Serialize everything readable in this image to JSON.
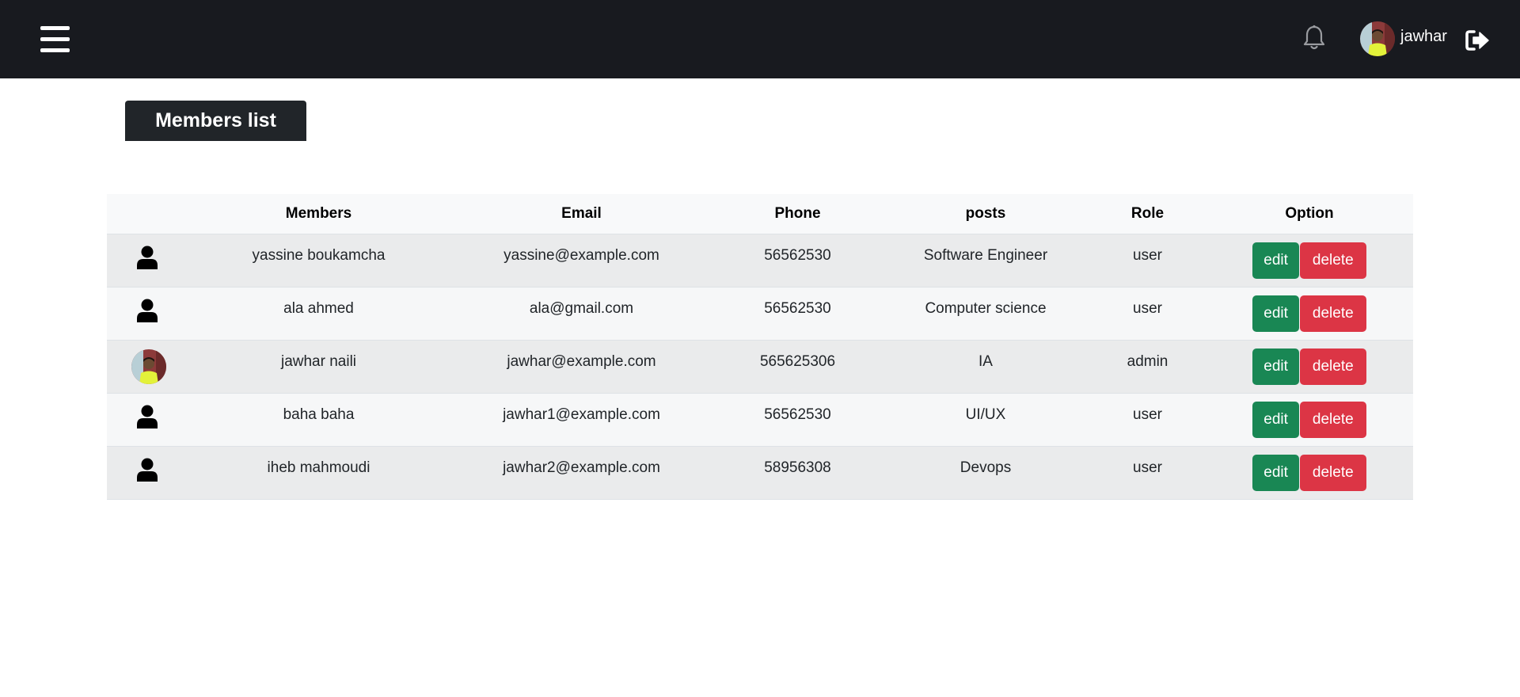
{
  "header": {
    "username": "jawhar"
  },
  "page": {
    "title": "Members list"
  },
  "table": {
    "columns": [
      "",
      "Members",
      "Email",
      "Phone",
      "posts",
      "Role",
      "Option"
    ],
    "rows": [
      {
        "avatar": "person-icon",
        "name": "yassine boukamcha",
        "email": "yassine@example.com",
        "phone": "56562530",
        "post": "Software Engineer",
        "role": "user"
      },
      {
        "avatar": "person-icon",
        "name": "ala ahmed",
        "email": "ala@gmail.com",
        "phone": "56562530",
        "post": "Computer science",
        "role": "user"
      },
      {
        "avatar": "photo-avatar",
        "name": "jawhar naili",
        "email": "jawhar@example.com",
        "phone": "565625306",
        "post": "IA",
        "role": "admin"
      },
      {
        "avatar": "person-icon",
        "name": "baha baha",
        "email": "jawhar1@example.com",
        "phone": "56562530",
        "post": "UI/UX",
        "role": "user"
      },
      {
        "avatar": "person-icon",
        "name": "iheb mahmoudi",
        "email": "jawhar2@example.com",
        "phone": "58956308",
        "post": "Devops",
        "role": "user"
      }
    ],
    "edit_label": "edit",
    "delete_label": "delete"
  },
  "colors": {
    "topbar": "#181a1f",
    "title_bg": "#212529",
    "edit": "#198754",
    "delete": "#dc3545"
  }
}
